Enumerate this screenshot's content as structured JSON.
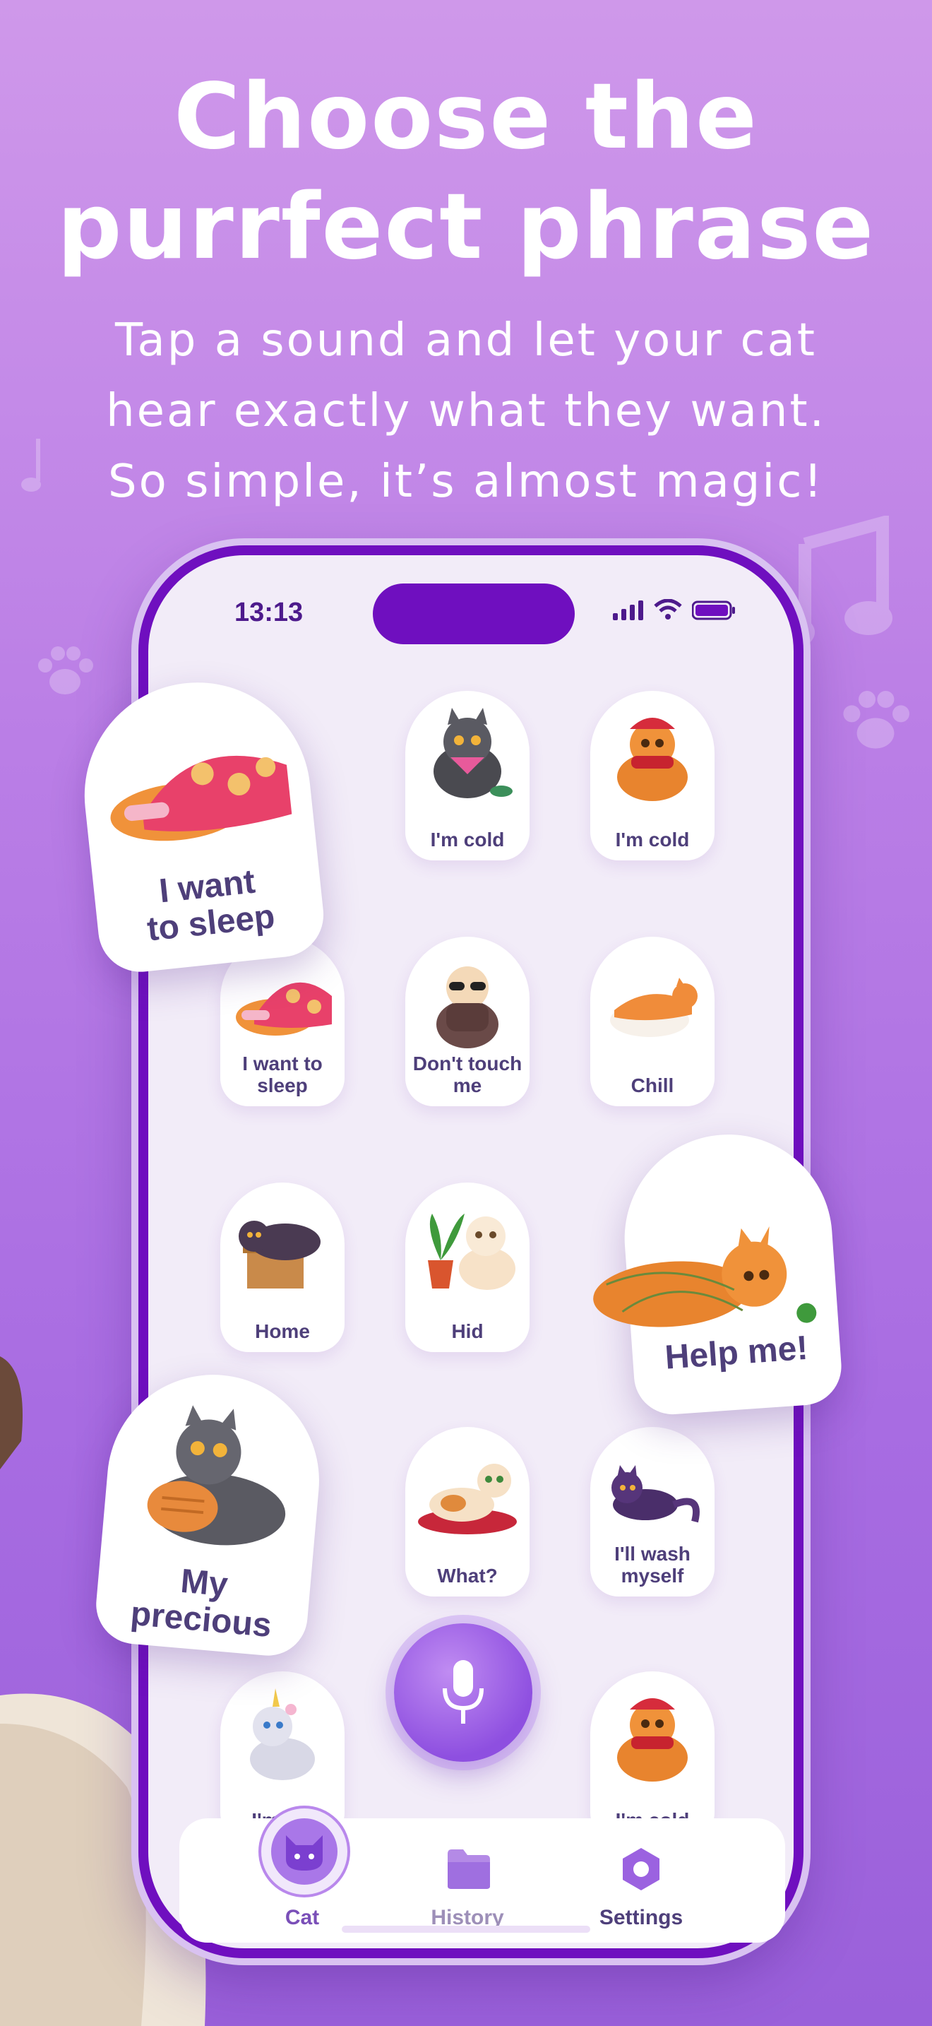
{
  "headline": {
    "line1": "Choose the",
    "line2": "purrfect phrase"
  },
  "subline": {
    "line1": "Tap a sound and let your cat",
    "line2": "hear exactly what they want.",
    "line3": "So simple, it’s almost magic!"
  },
  "status": {
    "time": "13:13"
  },
  "cards": [
    {
      "label": "I'm cold",
      "icon": "cat-bandana-icon"
    },
    {
      "label": "I'm cold",
      "icon": "cat-scarf-icon"
    },
    {
      "label": "I want to sleep",
      "icon": "cat-sleep-icon"
    },
    {
      "label": "Don't touch me",
      "icon": "cat-sunglasses-icon"
    },
    {
      "label": "Chill",
      "icon": "cat-sushi-icon"
    },
    {
      "label": "Home",
      "icon": "cat-box-icon"
    },
    {
      "label": "Hid",
      "icon": "cat-plant-icon"
    },
    {
      "label": "What?",
      "icon": "cat-cushion-icon"
    },
    {
      "label": "I'll wash myself",
      "icon": "cat-wash-icon"
    },
    {
      "label": "I'm cat",
      "icon": "cat-unicorn-icon"
    },
    {
      "label": "I'm cold",
      "icon": "cat-scarf-icon"
    }
  ],
  "featured": [
    {
      "label_line1": "I want",
      "label_line2": "to sleep"
    },
    {
      "label_line1": "Help me!",
      "label_line2": ""
    },
    {
      "label_line1": "My",
      "label_line2": "precious"
    }
  ],
  "tabbar": {
    "tabs": [
      {
        "label": "Cat",
        "icon": "cat-face-icon",
        "active": true
      },
      {
        "label": "History",
        "icon": "folder-icon",
        "active": false
      },
      {
        "label": "Settings",
        "icon": "gear-icon",
        "active": false
      }
    ]
  },
  "colors": {
    "accent": "#6f0fbf",
    "label": "#4e3f7a",
    "background": "#b47ae4"
  }
}
